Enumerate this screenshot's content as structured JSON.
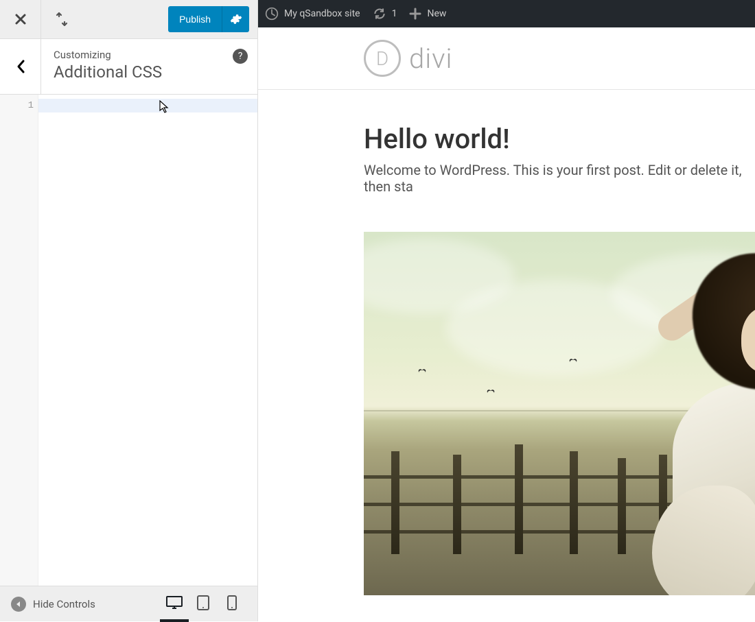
{
  "colors": {
    "accent": "#0084bd"
  },
  "customizer": {
    "publish_label": "Publish",
    "breadcrumb": {
      "kicker": "Customizing",
      "title": "Additional CSS"
    },
    "help_glyph": "?",
    "editor": {
      "lines": [
        "1"
      ],
      "value": ""
    },
    "footer": {
      "hide_controls_label": "Hide Controls",
      "active_device": "desktop"
    }
  },
  "adminbar": {
    "site_name": "My qSandbox site",
    "refresh_count": "1",
    "new_label": "New"
  },
  "preview": {
    "logo_text": "divi",
    "post": {
      "title": "Hello world!",
      "body": "Welcome to WordPress. This is your first post. Edit or delete it, then sta"
    }
  }
}
